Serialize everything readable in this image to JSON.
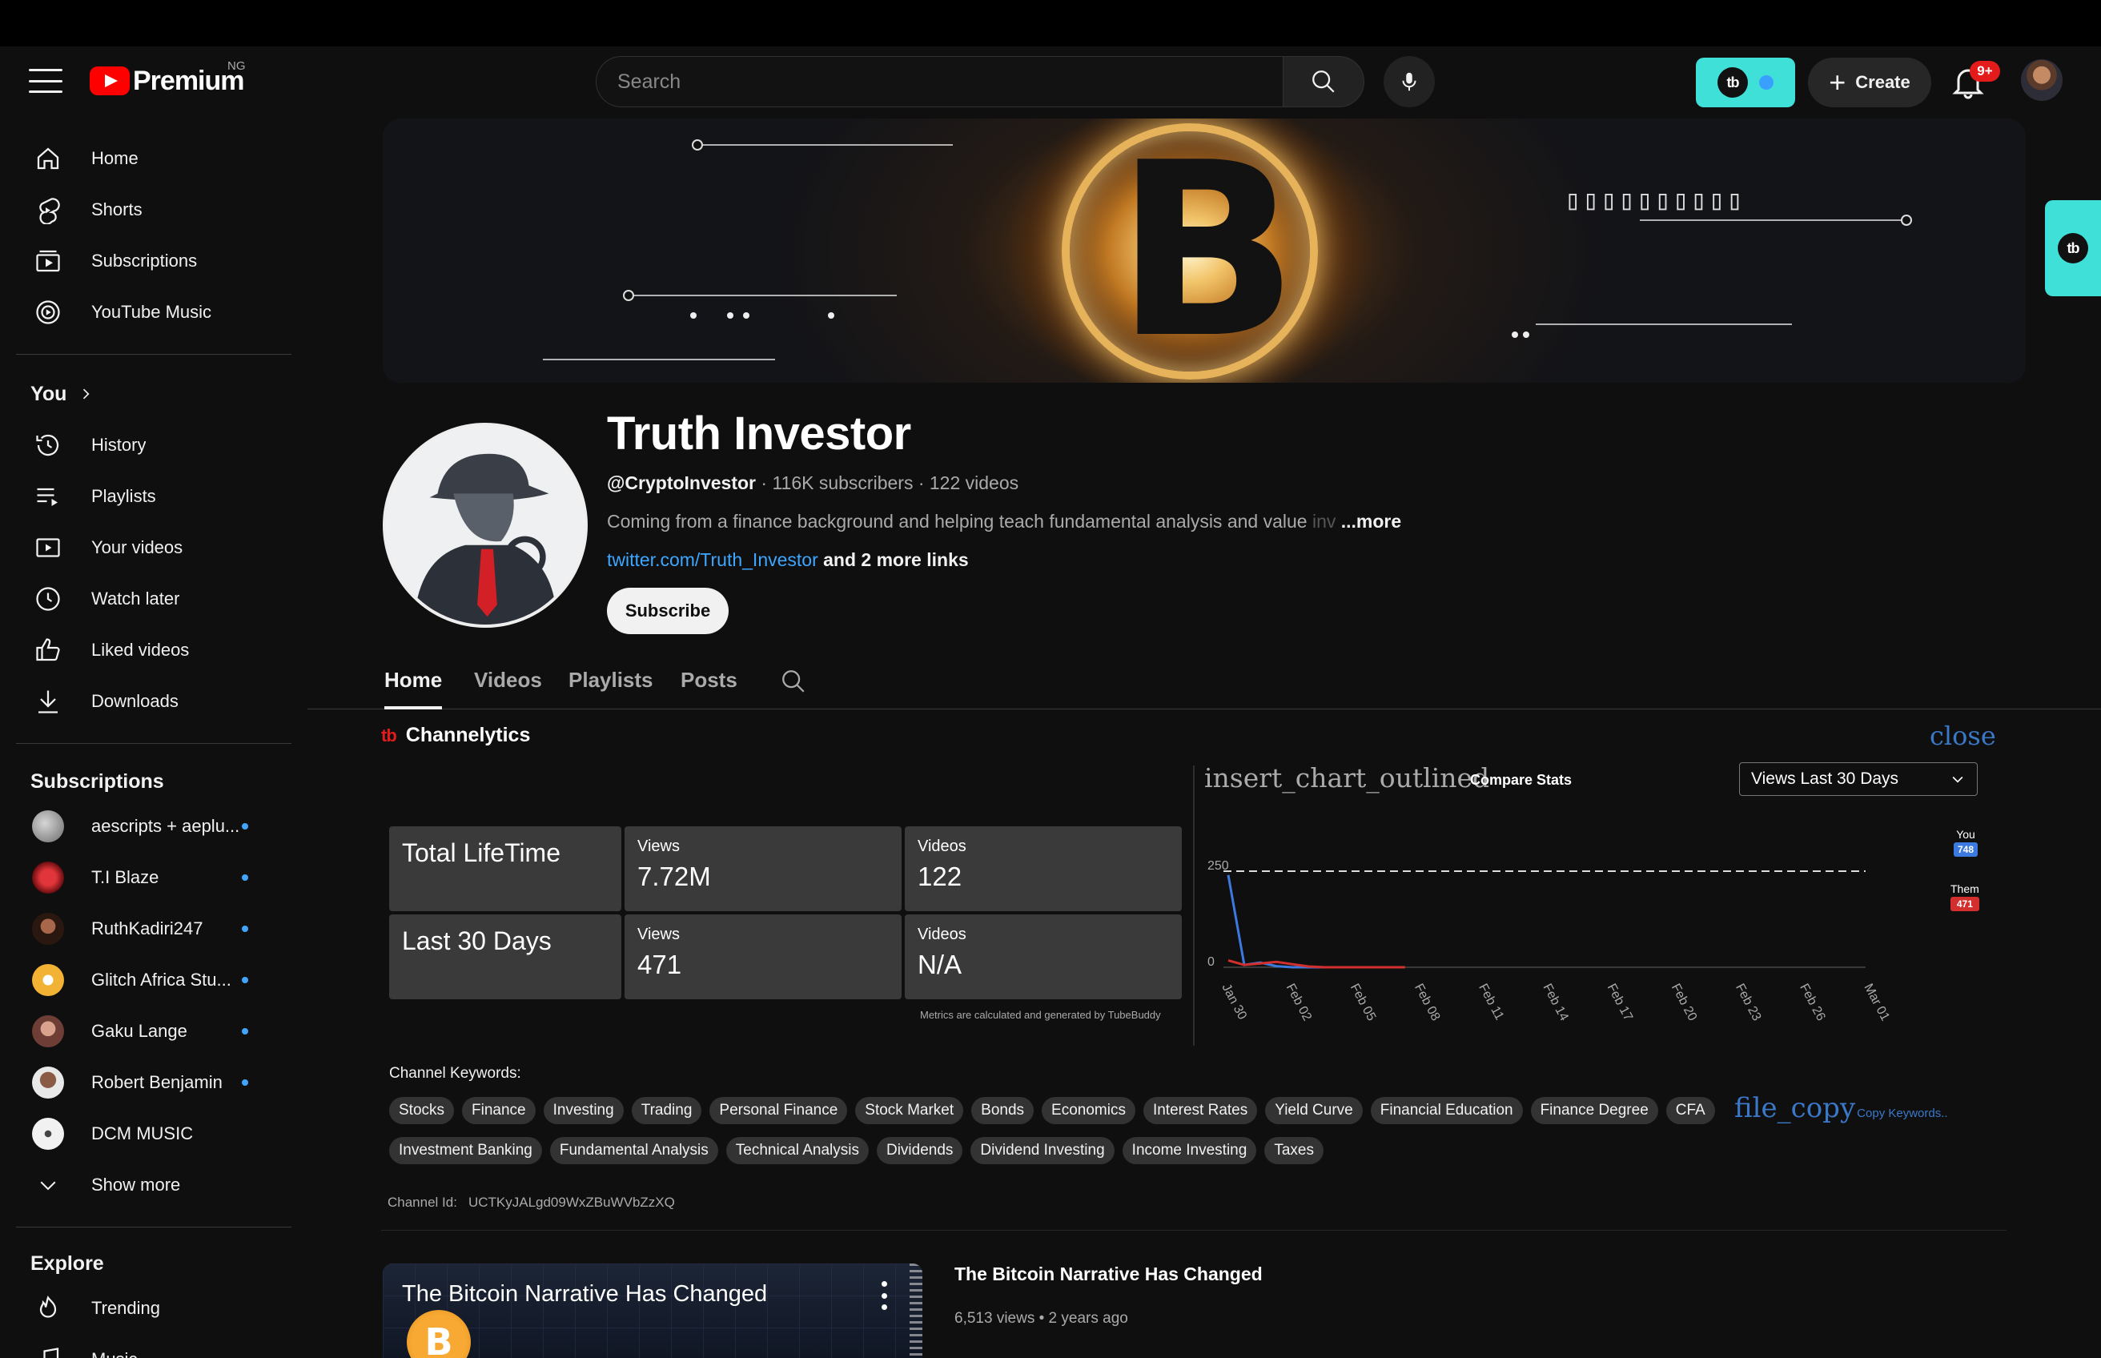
{
  "masthead": {
    "logo_text": "Premium",
    "region": "NG",
    "search_placeholder": "Search",
    "create_label": "Create",
    "notifications_badge": "9+"
  },
  "sidebar": {
    "main": [
      {
        "label": "Home",
        "icon": "home-icon"
      },
      {
        "label": "Shorts",
        "icon": "shorts-icon"
      },
      {
        "label": "Subscriptions",
        "icon": "subscriptions-icon"
      },
      {
        "label": "YouTube Music",
        "icon": "youtube-music-icon"
      }
    ],
    "you_heading": "You",
    "you": [
      {
        "label": "History",
        "icon": "history-icon"
      },
      {
        "label": "Playlists",
        "icon": "playlists-icon"
      },
      {
        "label": "Your videos",
        "icon": "your-videos-icon"
      },
      {
        "label": "Watch later",
        "icon": "watch-later-icon"
      },
      {
        "label": "Liked videos",
        "icon": "liked-videos-icon"
      },
      {
        "label": "Downloads",
        "icon": "downloads-icon"
      }
    ],
    "subscriptions_heading": "Subscriptions",
    "subscriptions": [
      {
        "label": "aescripts + aeplu...",
        "color": "#9a9a9a",
        "new": true
      },
      {
        "label": "T.I Blaze",
        "color": "#c0272d",
        "new": true
      },
      {
        "label": "RuthKadiri247",
        "color": "#8b4a2e",
        "new": true
      },
      {
        "label": "Glitch Africa Stu...",
        "color": "#f2b233",
        "new": true
      },
      {
        "label": "Gaku Lange",
        "color": "#b07a6a",
        "new": true
      },
      {
        "label": "Robert Benjamin",
        "color": "#6e4b3a",
        "new": true
      },
      {
        "label": "DCM MUSIC",
        "color": "#f1f1f1",
        "new": false
      }
    ],
    "show_more": "Show more",
    "explore_heading": "Explore",
    "explore": [
      {
        "label": "Trending",
        "icon": "trending-icon"
      },
      {
        "label": "Music",
        "icon": "music-icon"
      }
    ]
  },
  "banner": {
    "symbol": "B",
    "boxes": "▯▯▯▯▯▯▯▯▯▯"
  },
  "channel": {
    "name": "Truth Investor",
    "handle": "@CryptoInvestor",
    "stats": "· 116K subscribers · 122 videos",
    "description": "Coming from a finance background and helping teach fundamental analysis and value ",
    "description_fade": "inv",
    "more": "...more",
    "link": "twitter.com/Truth_Investor",
    "more_links": "and 2 more links",
    "subscribe": "Subscribe"
  },
  "tabs": [
    "Home",
    "Videos",
    "Playlists",
    "Posts"
  ],
  "channelytics": {
    "brand": "tb",
    "title": "Channelytics",
    "close": "close",
    "total_label": "Total LifeTime",
    "total_views_label": "Views",
    "total_views": "7.72M",
    "total_videos_label": "Videos",
    "total_videos": "122",
    "last_label": "Last 30 Days",
    "last_views_label": "Views",
    "last_views": "471",
    "last_videos_label": "Videos",
    "last_videos": "N/A",
    "metrics_note": "Metrics are calculated and generated by TubeBuddy",
    "compare_icon": "insert_chart_outlined",
    "compare_label": "Compare Stats",
    "range_select": "Views Last 30 Days",
    "legend": {
      "you_label": "You",
      "you_value": "748",
      "you_color": "#3d7ae0",
      "them_label": "Them",
      "them_value": "471",
      "them_color": "#d32f2f"
    },
    "keywords_title": "Channel Keywords:",
    "keywords_row1": [
      "Stocks",
      "Finance",
      "Investing",
      "Trading",
      "Personal Finance",
      "Stock Market",
      "Bonds",
      "Economics",
      "Interest Rates",
      "Yield Curve",
      "Financial Education",
      "Finance Degree",
      "CFA"
    ],
    "keywords_row2": [
      "Investment Banking",
      "Fundamental Analysis",
      "Technical Analysis",
      "Dividends",
      "Dividend Investing",
      "Income Investing",
      "Taxes"
    ],
    "copy_icon": "file_copy",
    "copy_label": "Copy Keywords..",
    "channel_id_label": "Channel Id:",
    "channel_id": "UCTKyJALgd09WxZBuWVbZzXQ"
  },
  "chart_data": {
    "type": "line",
    "categories": [
      "Jan 30",
      "Feb 02",
      "Feb 05",
      "Feb 08",
      "Feb 11",
      "Feb 14",
      "Feb 17",
      "Feb 20",
      "Feb 23",
      "Feb 26",
      "Mar 01"
    ],
    "y_ticks": [
      "0",
      "250"
    ],
    "ylim": [
      0,
      250
    ],
    "threshold": 250,
    "series": [
      {
        "name": "You",
        "color": "#3d7ae0",
        "values": [
          240,
          6,
          12,
          3,
          0,
          0,
          0,
          0,
          0,
          0,
          0,
          0
        ]
      },
      {
        "name": "Them",
        "color": "#d32f2f",
        "values": [
          18,
          6,
          10,
          14,
          8,
          2,
          0,
          0,
          0,
          0,
          0,
          0
        ]
      }
    ]
  },
  "featured_video": {
    "thumb_title": "The Bitcoin Narrative Has Changed",
    "thumb_symbol": "B",
    "title": "The Bitcoin Narrative Has Changed",
    "meta": "6,513 views • 2 years ago"
  }
}
